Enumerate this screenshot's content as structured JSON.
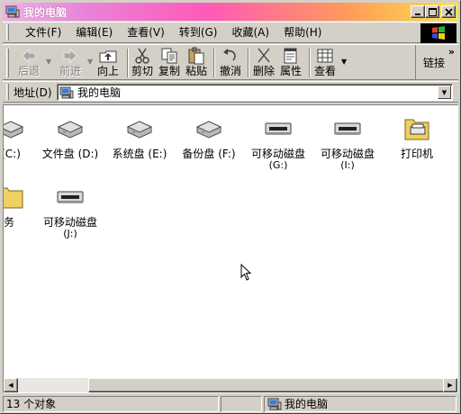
{
  "window": {
    "title": "我的电脑"
  },
  "menu": [
    "文件(F)",
    "编辑(E)",
    "查看(V)",
    "转到(G)",
    "收藏(A)",
    "帮助(H)"
  ],
  "toolbar": {
    "back": "后退",
    "forward": "前进",
    "up": "向上",
    "cut": "剪切",
    "copy": "复制",
    "paste": "粘贴",
    "undo": "撤消",
    "delete": "删除",
    "properties": "属性",
    "views": "查看",
    "links": "链接"
  },
  "address": {
    "label": "地址(D)",
    "value": "我的电脑"
  },
  "items": [
    {
      "name": "(C:)",
      "sub": ""
    },
    {
      "name": "文件盘 (D:)",
      "sub": ""
    },
    {
      "name": "系统盘 (E:)",
      "sub": ""
    },
    {
      "name": "备份盘 (F:)",
      "sub": ""
    },
    {
      "name": "可移动磁盘",
      "sub": "(G:)"
    },
    {
      "name": "可移动磁盘",
      "sub": "(I:)"
    },
    {
      "name": "打印机",
      "sub": ""
    },
    {
      "name": "任务",
      "sub": ""
    },
    {
      "name": "可移动磁盘",
      "sub": "(J:)"
    }
  ],
  "status": {
    "count": "13 个对象",
    "location": "我的电脑"
  }
}
